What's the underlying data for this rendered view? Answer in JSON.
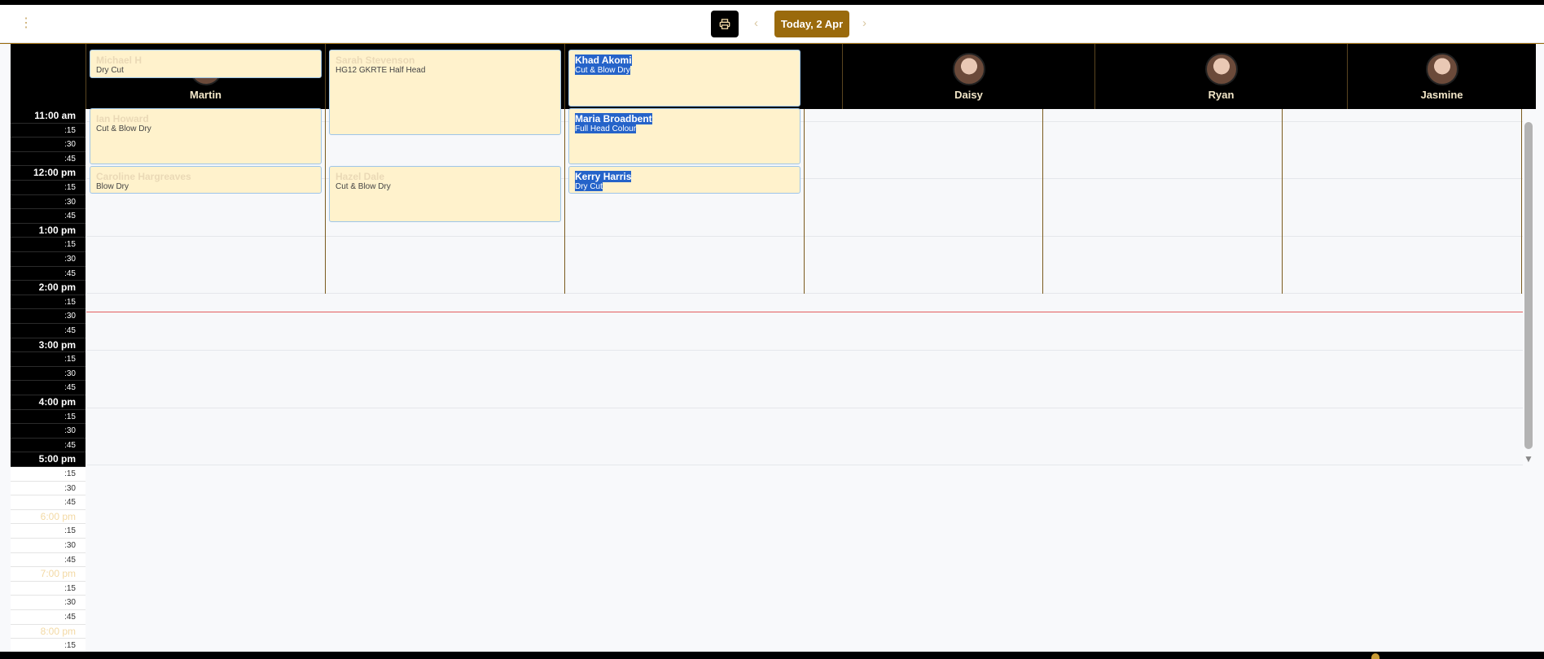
{
  "toolbar": {
    "menu_icon": "more-vertical-icon",
    "print_icon": "printer-icon",
    "prev": "‹",
    "next": "›",
    "today_label": "Today, 2 Apr"
  },
  "staff": [
    {
      "name": "Martin"
    },
    {
      "name": ""
    },
    {
      "name": ""
    },
    {
      "name": "Daisy"
    },
    {
      "name": "Ryan"
    },
    {
      "name": "Jasmine"
    }
  ],
  "times": [
    "11:00 am",
    ":15",
    ":30",
    ":45",
    "12:00 pm",
    ":15",
    ":30",
    ":45",
    "1:00 pm",
    ":15",
    ":30",
    ":45",
    "2:00 pm",
    ":15",
    ":30",
    ":45",
    "3:00 pm",
    ":15",
    ":30",
    ":45",
    "4:00 pm",
    ":15",
    ":30",
    ":45",
    "5:00 pm",
    ":15",
    ":30",
    ":45",
    "6:00 pm",
    ":15",
    ":30",
    ":45",
    "7:00 pm",
    ":15",
    ":30",
    ":45",
    "8:00 pm",
    ":15"
  ],
  "appointments": [
    {
      "client": "Michael H",
      "service": "Dry Cut"
    },
    {
      "client": "Ian Howard",
      "service": "Cut & Blow Dry"
    },
    {
      "client": "Caroline Hargreaves",
      "service": "Blow Dry"
    },
    {
      "client": "Sarah Stevenson",
      "service": "HG12 GKRTE Half Head"
    },
    {
      "client": "Hazel Dale",
      "service": "Cut & Blow Dry"
    },
    {
      "client": "Khad Akomi",
      "service": "Cut & Blow Dry"
    },
    {
      "client": "Maria Broadbent",
      "service": "Full Head Colour"
    },
    {
      "client": "Kerry Harris",
      "service": "Dry Cut"
    }
  ],
  "colors": {
    "accent": "#9a6a0c",
    "header_bg": "#000000",
    "appointment_bg": "#fff2cc",
    "selection": "#2563c9",
    "current_time_line": "#e35c5c"
  }
}
